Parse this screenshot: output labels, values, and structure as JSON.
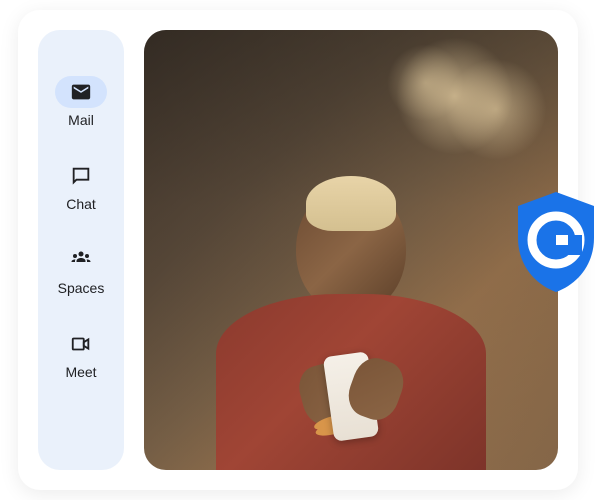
{
  "sidebar": {
    "items": [
      {
        "label": "Mail",
        "icon": "mail-icon",
        "active": true
      },
      {
        "label": "Chat",
        "icon": "chat-icon",
        "active": false
      },
      {
        "label": "Spaces",
        "icon": "spaces-icon",
        "active": false
      },
      {
        "label": "Meet",
        "icon": "meet-icon",
        "active": false
      }
    ]
  },
  "badge": {
    "letter": "G"
  }
}
